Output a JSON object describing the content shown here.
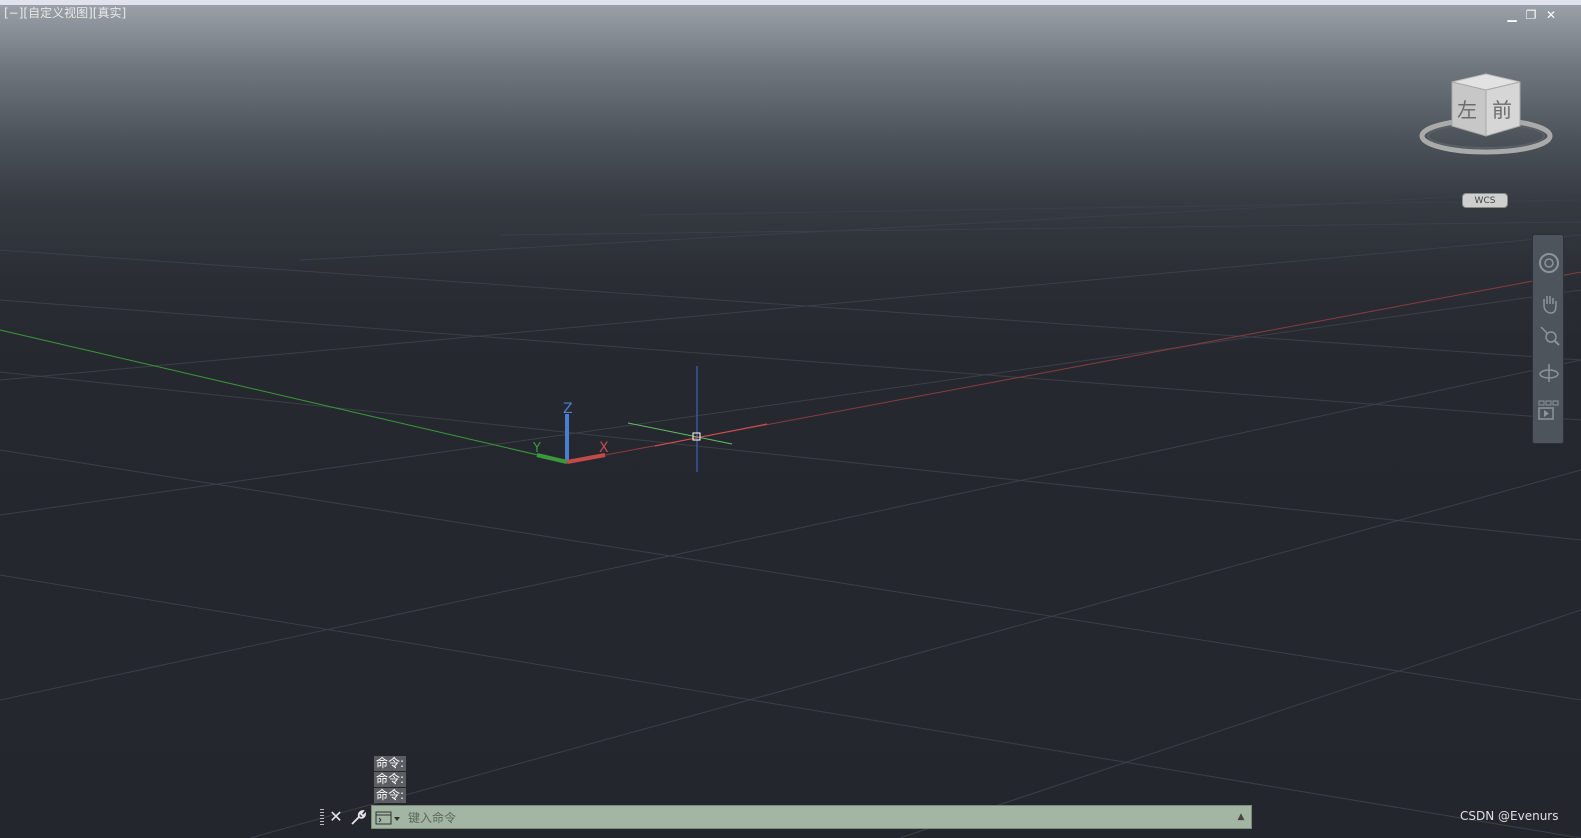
{
  "viewport": {
    "control_label": "[−]",
    "view_label": "[自定义视图]",
    "style_label": "[真实]"
  },
  "window_controls": {
    "minimize": "▁",
    "restore": "❐",
    "close": "✕"
  },
  "viewcube": {
    "left_face": "左",
    "front_face": "前"
  },
  "ucs_badge": "WCS",
  "axis_labels": {
    "x": "X",
    "y": "Y",
    "z": "Z"
  },
  "command_line": {
    "history": [
      "命令:",
      "命令:",
      "命令:"
    ],
    "placeholder": "键入命令",
    "close_glyph": "✕",
    "history_toggle_glyph": "▲"
  },
  "watermark": "CSDN @Evenurs",
  "colors": {
    "x_axis": "#c44a4a",
    "y_axis": "#3a9a3a",
    "z_axis": "#4a7fd0",
    "grid": "#3a4048",
    "command_bg": "#a3b6a3"
  },
  "icons": {
    "nav_bar": [
      "steering-wheel-icon",
      "pan-icon",
      "zoom-icon",
      "orbit-icon",
      "showmotion-icon"
    ],
    "command_settings": "wrench-icon",
    "command_prompt": "command-prompt-icon"
  }
}
